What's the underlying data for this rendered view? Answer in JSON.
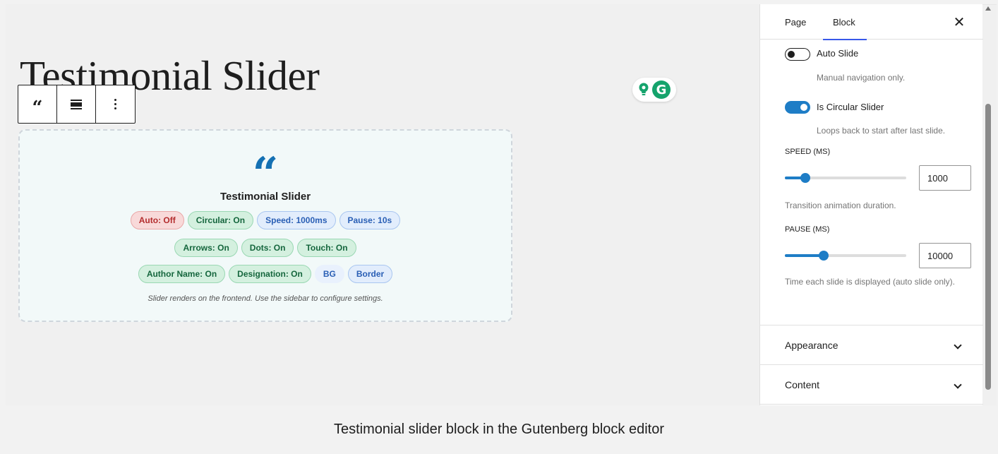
{
  "editor": {
    "page_title": "Testimonial Slider",
    "block_toolbar": {
      "quote_glyph": "“",
      "icons": [
        "quote-icon",
        "align-icon",
        "more-options-icon"
      ]
    },
    "grammarly": {
      "g_letter": "G"
    }
  },
  "slider_block": {
    "quote_glyph": "“",
    "title": "Testimonial Slider",
    "chip_rows": [
      [
        {
          "label": "Auto: Off",
          "status": "off"
        },
        {
          "label": "Circular: On",
          "status": "on"
        },
        {
          "label": "Speed: 1000ms",
          "status": "info"
        },
        {
          "label": "Pause: 10s",
          "status": "info"
        }
      ],
      [
        {
          "label": "Arrows: On",
          "status": "on"
        },
        {
          "label": "Dots: On",
          "status": "on"
        },
        {
          "label": "Touch: On",
          "status": "on"
        }
      ],
      [
        {
          "label": "Author Name: On",
          "status": "on"
        },
        {
          "label": "Designation: On",
          "status": "on"
        },
        {
          "label": "BG",
          "status": "info"
        },
        {
          "label": "Border",
          "status": "info"
        }
      ]
    ],
    "note": "Slider renders on the frontend. Use the sidebar to configure settings."
  },
  "sidebar": {
    "tabs": [
      {
        "label": "Page",
        "active": false
      },
      {
        "label": "Block",
        "active": true
      }
    ],
    "close_glyph": "✕",
    "auto_slide": {
      "label": "Auto Slide",
      "help": "Manual navigation only.",
      "enabled": false
    },
    "circular": {
      "label": "Is Circular Slider",
      "help": "Loops back to start after last slide.",
      "enabled": true
    },
    "speed": {
      "label": "SPEED (MS)",
      "value": "1000",
      "slider_fraction": 0.17,
      "help": "Transition animation duration."
    },
    "pause": {
      "label": "PAUSE (MS)",
      "value": "10000",
      "slider_fraction": 0.32,
      "help": "Time each slide is displayed (auto slide only)."
    },
    "panels": [
      {
        "label": "Appearance",
        "expanded": false
      },
      {
        "label": "Content",
        "expanded": false
      }
    ]
  },
  "caption": "Testimonial slider block in the Gutenberg block editor",
  "colors": {
    "accent": "#1e7dc6",
    "tab_indicator": "#3858e9",
    "quote_blue": "#1571b3",
    "chip_off": "#b32d2e",
    "chip_on": "#15663d",
    "chip_info": "#2a5fb5"
  }
}
